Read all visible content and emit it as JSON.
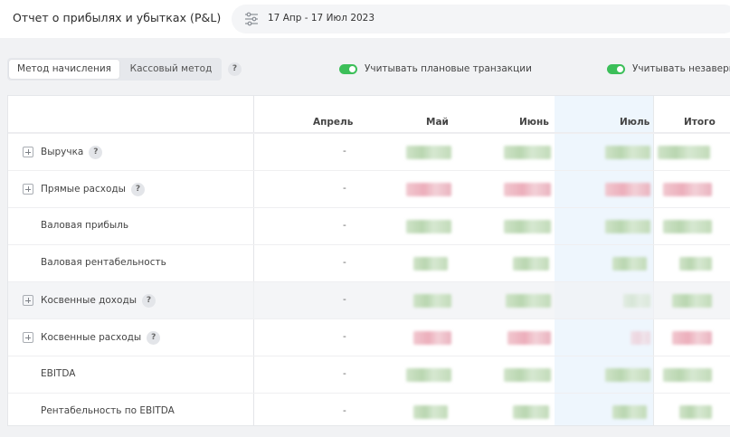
{
  "header": {
    "title": "Отчет о прибылях и убытках (P&L)",
    "date_range": "17 Апр - 17 Июл 2023",
    "filter_icon": "filter-sliders-icon"
  },
  "method_toggle": {
    "options": [
      "Метод начисления",
      "Кассовый метод"
    ],
    "selected": "Метод начисления",
    "help": "?"
  },
  "switches": [
    {
      "label": "Учитывать плановые транзакции",
      "on": true
    },
    {
      "label": "Учитывать незаверш",
      "on": true
    }
  ],
  "table": {
    "columns": [
      "Апрель",
      "Май",
      "Июнь",
      "Июль",
      "Итого"
    ],
    "rows": [
      {
        "label": "Выручка",
        "expandable": true,
        "help": "?",
        "april": "-"
      },
      {
        "label": "Прямые расходы",
        "expandable": true,
        "help": "?",
        "april": "-"
      },
      {
        "label": "Валовая прибыль",
        "expandable": false,
        "april": "-"
      },
      {
        "label": "Валовая рентабельность",
        "expandable": false,
        "april": "-"
      },
      {
        "label": "Косвенные доходы",
        "expandable": true,
        "help": "?",
        "april": "-"
      },
      {
        "label": "Косвенные расходы",
        "expandable": true,
        "help": "?",
        "april": "-"
      },
      {
        "label": "EBITDA",
        "expandable": false,
        "april": "-"
      },
      {
        "label": "Рентабельность по EBITDA",
        "expandable": false,
        "april": "-"
      }
    ]
  },
  "colors": {
    "accent_green": "#3cbf59",
    "positive_blur": "#c2dbb9",
    "negative_blur": "#ecaebb",
    "highlight_column": "#eef6fd"
  }
}
